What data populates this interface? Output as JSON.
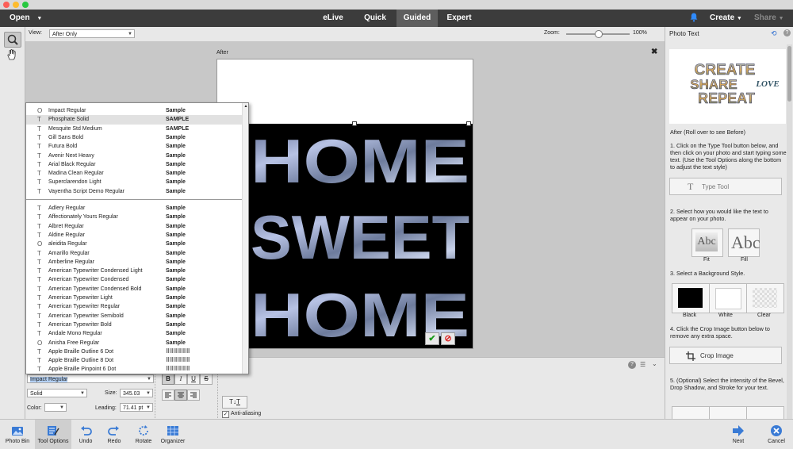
{
  "menu": {
    "open": "Open",
    "modes": [
      "eLive",
      "Quick",
      "Guided",
      "Expert"
    ],
    "active_mode": "Guided",
    "create": "Create",
    "share": "Share"
  },
  "viewbar": {
    "view_label": "View:",
    "view_value": "After Only",
    "zoom_label": "Zoom:",
    "zoom_value": "100%",
    "zoom_fraction": 0.5
  },
  "canvas": {
    "after_label": "After",
    "text_lines": [
      "HOME",
      "SWEET",
      "HOME"
    ],
    "colors": {
      "background": "#000000",
      "photo_fill": "#8a96b8"
    }
  },
  "font_dropdown": {
    "recent": [
      {
        "icon": "O",
        "name": "Impact Regular",
        "sample": "Sample"
      },
      {
        "icon": "T",
        "name": "Phosphate Solid",
        "sample": "SAMPLE"
      },
      {
        "icon": "T",
        "name": "Mesquite Std Medium",
        "sample": "SAMPLE"
      },
      {
        "icon": "T",
        "name": "Gill Sans Bold",
        "sample": "Sample"
      },
      {
        "icon": "T",
        "name": "Futura Bold",
        "sample": "Sample"
      },
      {
        "icon": "T",
        "name": "Avenir Next Heavy",
        "sample": "Sample"
      },
      {
        "icon": "T",
        "name": "Arial Black Regular",
        "sample": "Sample"
      },
      {
        "icon": "T",
        "name": "Madina Clean Regular",
        "sample": "Sample"
      },
      {
        "icon": "T",
        "name": "Superclarendon Light",
        "sample": "Sample"
      },
      {
        "icon": "T",
        "name": "Vayentha Script Demo Regular",
        "sample": "Sample"
      }
    ],
    "all": [
      {
        "icon": "T",
        "name": "Adlery Regular",
        "sample": "Sample"
      },
      {
        "icon": "T",
        "name": "Affectionately Yours Regular",
        "sample": "Sample"
      },
      {
        "icon": "T",
        "name": "Albret Regular",
        "sample": "Sample"
      },
      {
        "icon": "T",
        "name": "Aldine Regular",
        "sample": "Sample"
      },
      {
        "icon": "O",
        "name": "aleidita Regular",
        "sample": "Sample"
      },
      {
        "icon": "T",
        "name": "Amarillo Regular",
        "sample": "Sample"
      },
      {
        "icon": "T",
        "name": "Amberline Regular",
        "sample": "Sample"
      },
      {
        "icon": "T",
        "name": "American Typewriter Condensed Light",
        "sample": "Sample"
      },
      {
        "icon": "T",
        "name": "American Typewriter Condensed",
        "sample": "Sample"
      },
      {
        "icon": "T",
        "name": "American Typewriter Condensed Bold",
        "sample": "Sample"
      },
      {
        "icon": "T",
        "name": "American Typewriter Light",
        "sample": "Sample"
      },
      {
        "icon": "T",
        "name": "American Typewriter Regular",
        "sample": "Sample"
      },
      {
        "icon": "T",
        "name": "American Typewriter Semibold",
        "sample": "Sample"
      },
      {
        "icon": "T",
        "name": "American Typewriter Bold",
        "sample": "Sample"
      },
      {
        "icon": "T",
        "name": "Andale Mono Regular",
        "sample": "Sample"
      },
      {
        "icon": "O",
        "name": "Anisha Free Regular",
        "sample": "Sample"
      },
      {
        "icon": "T",
        "name": "Apple Braille Outline 6 Dot",
        "sample": "⠿⠿⠿⠿⠿⠿"
      },
      {
        "icon": "T",
        "name": "Apple Braille Outline 8 Dot",
        "sample": "⠿⠿⠿⠿⠿⠿"
      },
      {
        "icon": "T",
        "name": "Apple Braille Pinpoint 6 Dot",
        "sample": "⠿⠿⠿⠿⠿⠿"
      }
    ],
    "highlighted": "Phosphate Solid"
  },
  "tool_options": {
    "font_value": "Impact Regular",
    "style_value": "Solid",
    "size_label": "Size:",
    "size_value": "345.03",
    "color_label": "Color:",
    "leading_label": "Leading:",
    "leading_value": "71.41 pt",
    "bold": "B",
    "italic": "I",
    "underline": "U",
    "strike": "S",
    "anti_aliasing": "Anti-aliasing"
  },
  "right_panel": {
    "title": "Photo Text",
    "preview_words": [
      "CREATE",
      "SHARE",
      "LOVE",
      "REPEAT"
    ],
    "after_caption": "After (Roll over to see Before)",
    "step1": "1. Click on the Type Tool button below, and then click on your photo and start typing some text. (Use the Tool Options along the bottom to adjust the text style)",
    "type_tool": "Type Tool",
    "step2": "2. Select how you would like the text to appear on your photo.",
    "fit": "Fit",
    "fill": "Fill",
    "abc": "Abc",
    "step3": "3. Select a Background Style.",
    "black": "Black",
    "white": "White",
    "clear": "Clear",
    "step4": "4. Click the Crop Image button below to remove any extra space.",
    "crop_image": "Crop Image",
    "step5": "5. (Optional) Select the intensity of the Bevel, Drop Shadow, and Stroke for your text."
  },
  "bottom": {
    "photo_bin": "Photo Bin",
    "tool_options": "Tool Options",
    "undo": "Undo",
    "redo": "Redo",
    "rotate": "Rotate",
    "organizer": "Organizer",
    "next": "Next",
    "cancel": "Cancel"
  }
}
